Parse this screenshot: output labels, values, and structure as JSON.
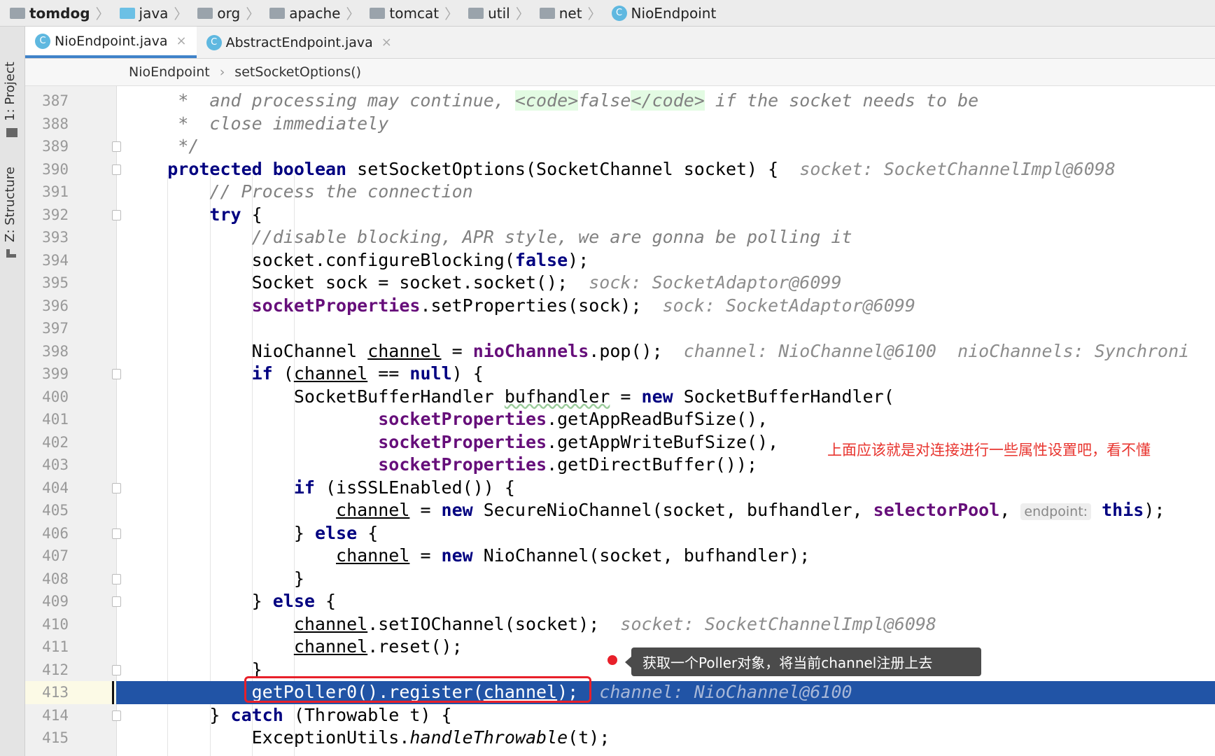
{
  "navbar": {
    "crumbs": [
      {
        "label": "tomdog",
        "icon": "project-folder-icon"
      },
      {
        "label": "java",
        "icon": "source-folder-icon"
      },
      {
        "label": "org",
        "icon": "package-icon"
      },
      {
        "label": "apache",
        "icon": "package-icon"
      },
      {
        "label": "tomcat",
        "icon": "package-icon"
      },
      {
        "label": "util",
        "icon": "package-icon"
      },
      {
        "label": "net",
        "icon": "package-icon"
      },
      {
        "label": "NioEndpoint",
        "icon": "class-icon"
      }
    ]
  },
  "sidebar": {
    "project": "1: Project",
    "structure": "Z: Structure"
  },
  "tabs": [
    {
      "label": "NioEndpoint.java",
      "active": true,
      "close": "×"
    },
    {
      "label": "AbstractEndpoint.java",
      "active": false,
      "close": "×"
    }
  ],
  "editor_breadcrumb": {
    "class": "NioEndpoint",
    "sep": "›",
    "method": "setSocketOptions()"
  },
  "colors": {
    "keyword": "#000080",
    "field": "#660e7a",
    "comment": "#808080",
    "highlight": "#2154a6",
    "annotation": "#e8352f"
  },
  "code": {
    "current_line": 413,
    "lines": [
      {
        "n": "387",
        "fold": false,
        "t": [
          [
            "cm",
            "     *  and processing may continue, "
          ],
          [
            "tag",
            "<code>"
          ],
          [
            "cm",
            "false"
          ],
          [
            "tag",
            "</code>"
          ],
          [
            "cm",
            " if the socket needs to be"
          ]
        ]
      },
      {
        "n": "388",
        "fold": false,
        "t": [
          [
            "cm",
            "     *  close immediately"
          ]
        ]
      },
      {
        "n": "389",
        "fold": true,
        "t": [
          [
            "cm",
            "     */"
          ]
        ]
      },
      {
        "n": "390",
        "fold": true,
        "t": [
          [
            "p",
            "    "
          ],
          [
            "kw",
            "protected"
          ],
          [
            "p",
            " "
          ],
          [
            "kw",
            "boolean"
          ],
          [
            "p",
            " setSocketOptions(SocketChannel socket) {"
          ],
          [
            "hint",
            "  socket: SocketChannelImpl@6098"
          ]
        ]
      },
      {
        "n": "391",
        "fold": false,
        "t": [
          [
            "cm",
            "        // Process the connection"
          ]
        ]
      },
      {
        "n": "392",
        "fold": true,
        "t": [
          [
            "p",
            "        "
          ],
          [
            "kw",
            "try"
          ],
          [
            "p",
            " {"
          ]
        ]
      },
      {
        "n": "393",
        "fold": false,
        "t": [
          [
            "cm",
            "            //disable blocking, APR style, we are gonna be polling it"
          ]
        ]
      },
      {
        "n": "394",
        "fold": false,
        "t": [
          [
            "p",
            "            socket.configureBlocking("
          ],
          [
            "kw",
            "false"
          ],
          [
            "p",
            ");"
          ]
        ]
      },
      {
        "n": "395",
        "fold": false,
        "t": [
          [
            "p",
            "            Socket sock = socket.socket();"
          ],
          [
            "hint",
            "  sock: SocketAdaptor@6099"
          ]
        ]
      },
      {
        "n": "396",
        "fold": false,
        "t": [
          [
            "p",
            "            "
          ],
          [
            "fld",
            "socketProperties"
          ],
          [
            "p",
            ".setProperties(sock);"
          ],
          [
            "hint",
            "  sock: SocketAdaptor@6099"
          ]
        ]
      },
      {
        "n": "397",
        "fold": false,
        "t": []
      },
      {
        "n": "398",
        "fold": false,
        "t": [
          [
            "p",
            "            NioChannel "
          ],
          [
            "u",
            "channel"
          ],
          [
            "p",
            " = "
          ],
          [
            "fld",
            "nioChannels"
          ],
          [
            "p",
            ".pop();"
          ],
          [
            "hint",
            "  channel: NioChannel@6100  nioChannels: Synchroni"
          ]
        ]
      },
      {
        "n": "399",
        "fold": true,
        "t": [
          [
            "p",
            "            "
          ],
          [
            "kw",
            "if"
          ],
          [
            "p",
            " ("
          ],
          [
            "u",
            "channel"
          ],
          [
            "p",
            " == "
          ],
          [
            "kw",
            "null"
          ],
          [
            "p",
            ") {"
          ]
        ]
      },
      {
        "n": "400",
        "fold": false,
        "t": [
          [
            "p",
            "                SocketBufferHandler "
          ],
          [
            "wavy",
            "bufhandler"
          ],
          [
            "p",
            " = "
          ],
          [
            "kw",
            "new"
          ],
          [
            "p",
            " SocketBufferHandler("
          ]
        ]
      },
      {
        "n": "401",
        "fold": false,
        "t": [
          [
            "p",
            "                        "
          ],
          [
            "fld",
            "socketProperties"
          ],
          [
            "p",
            ".getAppReadBufSize(),"
          ]
        ]
      },
      {
        "n": "402",
        "fold": false,
        "t": [
          [
            "p",
            "                        "
          ],
          [
            "fld",
            "socketProperties"
          ],
          [
            "p",
            ".getAppWriteBufSize(),"
          ]
        ]
      },
      {
        "n": "403",
        "fold": false,
        "t": [
          [
            "p",
            "                        "
          ],
          [
            "fld",
            "socketProperties"
          ],
          [
            "p",
            ".getDirectBuffer());"
          ]
        ]
      },
      {
        "n": "404",
        "fold": true,
        "t": [
          [
            "p",
            "                "
          ],
          [
            "kw",
            "if"
          ],
          [
            "p",
            " (isSSLEnabled()) {"
          ]
        ]
      },
      {
        "n": "405",
        "fold": false,
        "t": [
          [
            "p",
            "                    "
          ],
          [
            "u",
            "channel"
          ],
          [
            "p",
            " = "
          ],
          [
            "kw",
            "new"
          ],
          [
            "p",
            " SecureNioChannel(socket, bufhandler, "
          ],
          [
            "fld",
            "selectorPool"
          ],
          [
            "p",
            ", "
          ],
          [
            "param",
            "endpoint:"
          ],
          [
            "p",
            " "
          ],
          [
            "kw",
            "this"
          ],
          [
            "p",
            ");"
          ]
        ]
      },
      {
        "n": "406",
        "fold": true,
        "t": [
          [
            "p",
            "                } "
          ],
          [
            "kw",
            "else"
          ],
          [
            "p",
            " {"
          ]
        ]
      },
      {
        "n": "407",
        "fold": false,
        "t": [
          [
            "p",
            "                    "
          ],
          [
            "u",
            "channel"
          ],
          [
            "p",
            " = "
          ],
          [
            "kw",
            "new"
          ],
          [
            "p",
            " NioChannel(socket, bufhandler);"
          ]
        ]
      },
      {
        "n": "408",
        "fold": true,
        "t": [
          [
            "p",
            "                }"
          ]
        ]
      },
      {
        "n": "409",
        "fold": true,
        "t": [
          [
            "p",
            "            } "
          ],
          [
            "kw",
            "else"
          ],
          [
            "p",
            " {"
          ]
        ]
      },
      {
        "n": "410",
        "fold": false,
        "t": [
          [
            "p",
            "                "
          ],
          [
            "u",
            "channel"
          ],
          [
            "p",
            ".setIOChannel(socket);"
          ],
          [
            "hint",
            "  socket: SocketChannelImpl@6098"
          ]
        ]
      },
      {
        "n": "411",
        "fold": false,
        "t": [
          [
            "p",
            "                "
          ],
          [
            "u",
            "channel"
          ],
          [
            "p",
            ".reset();"
          ]
        ]
      },
      {
        "n": "412",
        "fold": true,
        "t": [
          [
            "p",
            "            }"
          ]
        ]
      },
      {
        "n": "413",
        "fold": false,
        "t": [
          [
            "p",
            "            getPoller0().register("
          ],
          [
            "u",
            "channel"
          ],
          [
            "p",
            ");"
          ],
          [
            "hint",
            "  channel: NioChannel@6100"
          ]
        ]
      },
      {
        "n": "414",
        "fold": true,
        "t": [
          [
            "p",
            "        } "
          ],
          [
            "kw",
            "catch"
          ],
          [
            "p",
            " (Throwable t) {"
          ]
        ]
      },
      {
        "n": "415",
        "fold": false,
        "t": [
          [
            "p",
            "            ExceptionUtils."
          ],
          [
            "ital",
            "handleThrowable"
          ],
          [
            "p",
            "(t);"
          ]
        ]
      }
    ]
  },
  "annotations": {
    "side_note": "上面应该就是对连接进行一些属性设置吧，看不懂",
    "tooltip": "获取一个Poller对象，将当前channel注册上去"
  }
}
